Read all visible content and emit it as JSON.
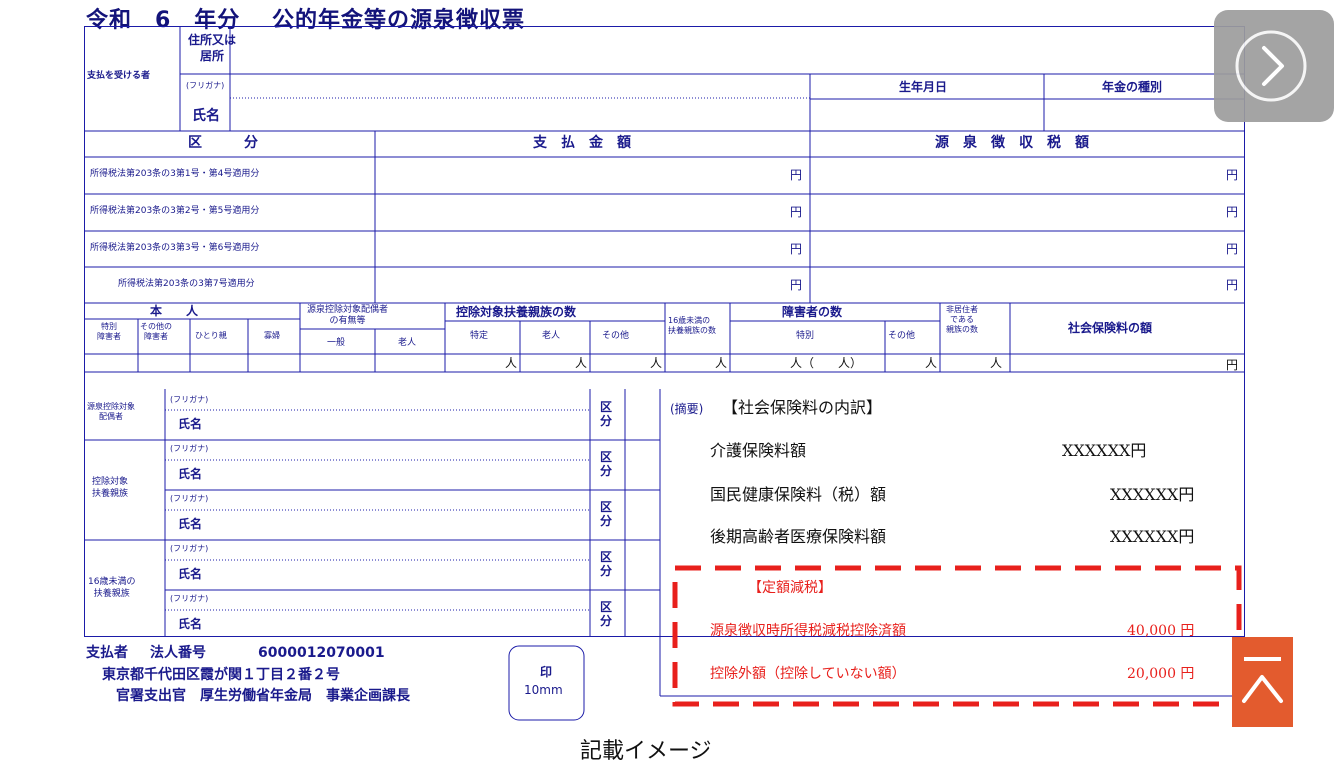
{
  "title": "令和　6　年分　 公的年金等の源泉徴収票",
  "recipient": {
    "section_label": "支払を受ける者",
    "address_label": "住所又は\n居所",
    "furigana_label": "(フリガナ)",
    "name_label": "氏名",
    "birthdate_header": "生年月日",
    "pension_type_header": "年金の種別"
  },
  "amounts": {
    "category_header": "区　　　分",
    "payment_header": "支　払　金　額",
    "withholding_header": "源　泉　徴　収　税　額",
    "yen": "円",
    "rows": [
      "所得税法第203条の3第1号・第4号適用分",
      "所得税法第203条の3第2号・第5号適用分",
      "所得税法第203条の3第3号・第6号適用分",
      "所得税法第203条の3第7号適用分"
    ]
  },
  "dependents_header": {
    "person": "本　　人",
    "special_disabled": "特別\n障害者",
    "other_disabled": "その他の\n障害者",
    "single_parent": "ひとり親",
    "widow": "寡婦",
    "spouse": "源泉控除対象配偶者\nの有無等",
    "general": "一般",
    "elderly": "老人",
    "dependents_count": "控除対象扶養親族の数",
    "specific": "特定",
    "elderly2": "老人",
    "other": "その他",
    "under16": "16歳未満の\n扶養親族の数",
    "disabled_count": "障害者の数",
    "special": "特別",
    "other2": "その他",
    "nonresident": "非居住者\nである\n親族の数",
    "social_insurance": "社会保険料の額",
    "person_unit": "人",
    "special_unit": "人（　　人）",
    "yen": "円"
  },
  "family": {
    "spouse_label": "源泉控除対象\n配偶者",
    "dependent_label": "控除対象\n扶養親族",
    "under16_label": "16歳未満の\n扶養親族",
    "furigana": "(フリガナ)",
    "name": "氏名",
    "category": "区\n分"
  },
  "remarks": {
    "label": "(摘要)",
    "heading": "【社会保険料の内訳】",
    "items": [
      {
        "label": "介護保険料額",
        "value": "XXXXXX円"
      },
      {
        "label": "国民健康保険料（税）額",
        "value": "XXXXXX円"
      },
      {
        "label": "後期高齢者医療保険料額",
        "value": "XXXXXX円"
      }
    ],
    "fixed_tax_heading": "【定額減税】",
    "fixed_items": [
      {
        "label": "源泉徴収時所得税減税控除済額",
        "value": "40,000 円"
      },
      {
        "label": "控除外額（控除していない額）",
        "value": "20,000 円"
      }
    ]
  },
  "payer": {
    "label": "支払者",
    "corp_number_label": "法人番号",
    "corp_number": "6000012070001",
    "address": "東京都千代田区霞が関１丁目２番２号",
    "name": "官署支出官　厚生労働省年金局　事業企画課長",
    "seal": "印",
    "seal_size": "10mm"
  },
  "caption": "記載イメージ",
  "colors": {
    "form_line": "#1b1ba8",
    "highlight": "#e8201c",
    "next_button": "#9d9d9d",
    "top_button": "#e35b2e"
  },
  "icons": {
    "next": "chevron-right-icon",
    "top": "arrow-up-icon"
  }
}
